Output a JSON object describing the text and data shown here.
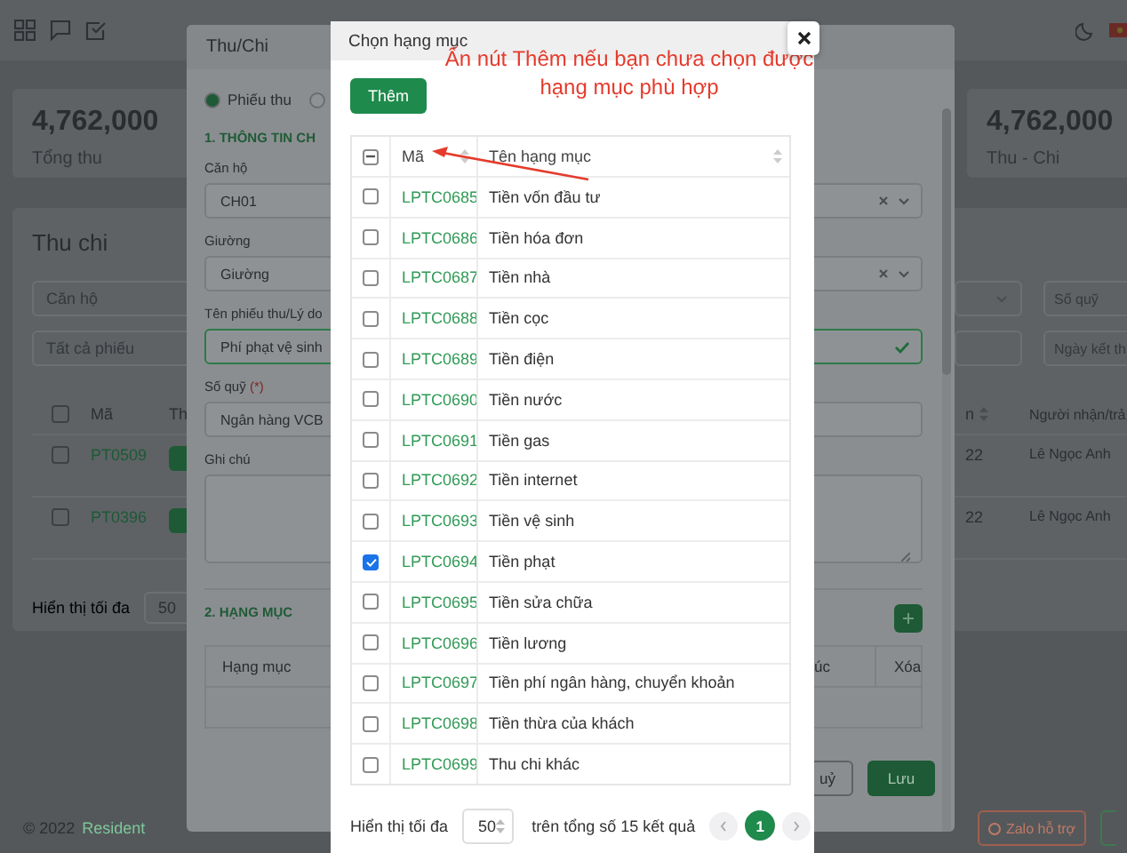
{
  "stats": [
    {
      "value": "4,762,000",
      "label": "Tổng thu"
    },
    {
      "value": "4,762,000",
      "label": "Thu - Chi"
    }
  ],
  "list_card": {
    "title": "Thu chi",
    "filters_left": [
      {
        "placeholder": "Căn hộ"
      },
      {
        "placeholder": "Tất cả phiếu"
      }
    ],
    "filters_right": [
      {
        "placeholder": "Số quỹ"
      },
      {
        "placeholder": "Ngày kết th"
      }
    ],
    "header_checked": false,
    "columns_left": [
      "Mã",
      "Th"
    ],
    "columns_right": [
      "n",
      "Người nhận/trả"
    ],
    "rows": [
      {
        "checked": false,
        "code": "PT0509",
        "date_tail": "22",
        "person": "Lê Ngọc Anh"
      },
      {
        "checked": false,
        "code": "PT0396",
        "date_tail": "22",
        "person": "Lê Ngọc Anh"
      }
    ],
    "page_size_label": "Hiển thị tối đa",
    "page_size": "50"
  },
  "footer": {
    "copyright": "© 2022",
    "brand": "Resident",
    "support_button": "Zalo hỗ trợ"
  },
  "voucher_dialog": {
    "title": "Thu/Chi",
    "radios": [
      {
        "label": "Phiếu thu",
        "selected": true
      },
      {
        "selected": false
      }
    ],
    "section_1": "1. THÔNG TIN CH",
    "fields": [
      {
        "kind": "select",
        "label": "Căn hộ",
        "value": "CH01"
      },
      {
        "kind": "select",
        "label": "Giường",
        "value": "Giường"
      },
      {
        "kind": "valid",
        "label": "Tên phiếu thu/Lý do",
        "value": "Phí phạt vệ sinh"
      },
      {
        "kind": "text",
        "label": "Số quỹ",
        "required_mark": "(*)",
        "value": "Ngân hàng VCB"
      },
      {
        "kind": "textarea",
        "label": "Ghi chú"
      }
    ],
    "section_2": "2. HẠNG MỤC",
    "item_columns": [
      "Hạng mục",
      "úc",
      "Xóa"
    ],
    "cancel_button": "uỷ",
    "save_button": "Lưu"
  },
  "category_dialog": {
    "title": "Chọn hạng mục",
    "add_button": "Thêm",
    "annotation": [
      "Ấn nút Thêm nếu bạn chưa chọn được",
      "hạng mục phù hợp"
    ],
    "header_indeterminate": true,
    "columns": [
      "Mã",
      "Tên hạng mục"
    ],
    "rows": [
      {
        "code": "LPTC0685",
        "name": "Tiền vốn đầu tư",
        "checked": false
      },
      {
        "code": "LPTC0686",
        "name": "Tiền hóa đơn",
        "checked": false
      },
      {
        "code": "LPTC0687",
        "name": "Tiền nhà",
        "checked": false
      },
      {
        "code": "LPTC0688",
        "name": "Tiền cọc",
        "checked": false
      },
      {
        "code": "LPTC0689",
        "name": "Tiền điện",
        "checked": false
      },
      {
        "code": "LPTC0690",
        "name": "Tiền nước",
        "checked": false
      },
      {
        "code": "LPTC0691",
        "name": "Tiền gas",
        "checked": false
      },
      {
        "code": "LPTC0692",
        "name": "Tiền internet",
        "checked": false
      },
      {
        "code": "LPTC0693",
        "name": "Tiền vệ sinh",
        "checked": false
      },
      {
        "code": "LPTC0694",
        "name": "Tiền phạt",
        "checked": true
      },
      {
        "code": "LPTC0695",
        "name": "Tiền sửa chữa",
        "checked": false
      },
      {
        "code": "LPTC0696",
        "name": "Tiền lương",
        "checked": false
      },
      {
        "code": "LPTC0697",
        "name": "Tiền phí ngân hàng, chuyển khoản",
        "checked": false
      },
      {
        "code": "LPTC0698",
        "name": "Tiền thừa của khách",
        "checked": false
      },
      {
        "code": "LPTC0699",
        "name": "Thu chi khác",
        "checked": false
      }
    ],
    "page_size_label": "Hiển thị tối đa",
    "page_size": "50",
    "total": "trên tổng số 15 kết quả",
    "pages": [
      {
        "label": "1",
        "selected": true
      }
    ]
  }
}
